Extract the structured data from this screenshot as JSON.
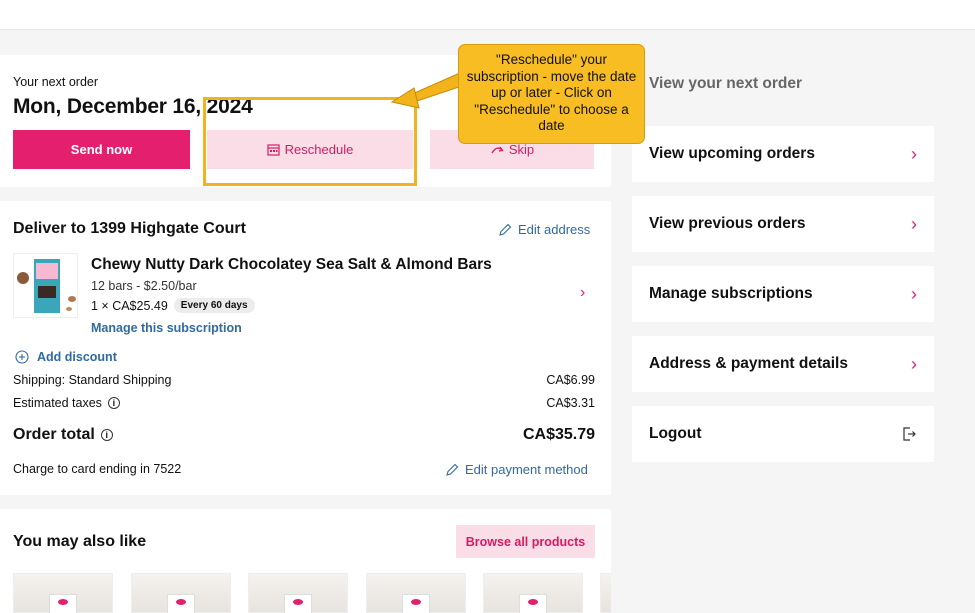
{
  "next_order": {
    "label": "Your next order",
    "date": "Mon, December 16, 2024",
    "send_now": "Send now",
    "reschedule": "Reschedule",
    "skip": "Skip"
  },
  "delivery": {
    "title": "Deliver to 1399 Highgate Court",
    "edit_address": "Edit address",
    "product": {
      "name": "Chewy Nutty Dark Chocolatey Sea Salt & Almond Bars",
      "sub": "12 bars - $2.50/bar",
      "qty_price": "1 × CA$25.49",
      "frequency": "Every 60 days",
      "manage": "Manage this subscription"
    },
    "add_discount": "Add discount",
    "shipping_label": "Shipping: Standard Shipping",
    "shipping_value": "CA$6.99",
    "taxes_label": "Estimated taxes",
    "taxes_value": "CA$3.31",
    "total_label": "Order total",
    "total_value": "CA$35.79",
    "card_label": "Charge to card ending in 7522",
    "edit_payment": "Edit payment method"
  },
  "also_like": {
    "title": "You may also like",
    "browse": "Browse all products"
  },
  "sidebar": {
    "items": [
      {
        "label": "View your next order"
      },
      {
        "label": "View upcoming orders"
      },
      {
        "label": "View previous orders"
      },
      {
        "label": "Manage subscriptions"
      },
      {
        "label": "Address & payment details"
      },
      {
        "label": "Logout"
      }
    ]
  },
  "annotation": {
    "text": "\"Reschedule\" your subscription - move the date up or later - Click on \"Reschedule\" to choose a date"
  },
  "colors": {
    "brand_pink": "#e4206e",
    "light_pink": "#fbdde8",
    "link_blue": "#2f6aa3",
    "callout_yellow": "#f7bd22"
  }
}
